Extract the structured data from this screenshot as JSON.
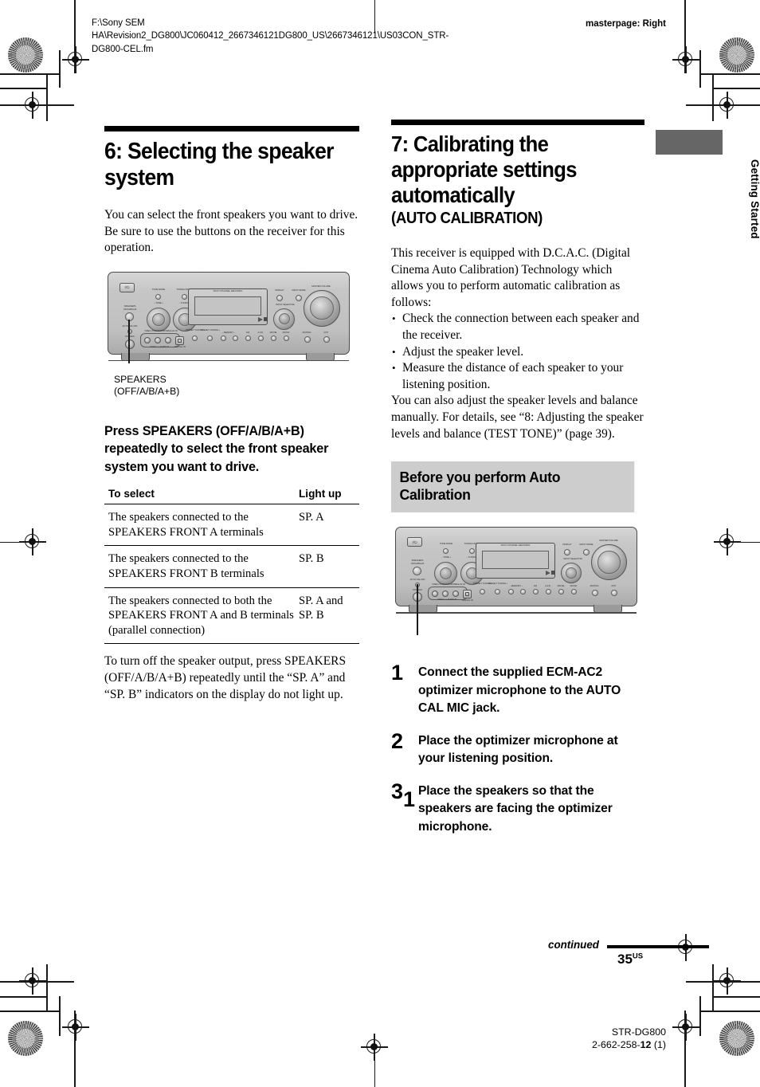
{
  "header": {
    "file_path": "F:\\Sony SEM HA\\Revision2_DG800\\JC060412_2667346121DG800_US\\2667346121\\US03CON_STR-DG800-CEL.fm",
    "masterpage": "masterpage: Right"
  },
  "side_tab": {
    "label": "Getting Started"
  },
  "left_column": {
    "heading": "6: Selecting the speaker system",
    "intro": "You can select the front speakers you want to drive.\nBe sure to use the buttons on the receiver for this operation.",
    "figure_caption": "SPEAKERS\n(OFF/A/B/A+B)",
    "instruction": "Press SPEAKERS (OFF/A/B/A+B) repeatedly to select the front speaker system you want to drive.",
    "table": {
      "headers": [
        "To select",
        "Light up"
      ],
      "rows": [
        [
          "The speakers connected to the SPEAKERS FRONT A terminals",
          "SP. A"
        ],
        [
          "The speakers connected to the SPEAKERS FRONT B terminals",
          "SP. B"
        ],
        [
          "The speakers connected to both the SPEAKERS FRONT A and B terminals (parallel connection)",
          "SP. A and SP. B"
        ]
      ]
    },
    "closing": "To turn off the speaker output, press SPEAKERS (OFF/A/B/A+B) repeatedly until the “SP. A” and “SP. B” indicators on the display do not light up."
  },
  "right_column": {
    "heading": "7: Calibrating the appropriate settings automatically",
    "heading_sub": "(AUTO CALIBRATION)",
    "intro": "This receiver is equipped with D.C.A.C. (Digital Cinema Auto Calibration) Technology which allows you to perform automatic calibration as follows:",
    "bullets": [
      "Check the connection between each speaker and the receiver.",
      "Adjust the speaker level.",
      "Measure the distance of each speaker to your listening position."
    ],
    "after_bullets": "You can also adjust the speaker levels and balance manually. For details, see “8: Adjusting the speaker levels and balance (TEST TONE)” (page 39).",
    "grey_heading": "Before you perform Auto Calibration",
    "figure_callout": "1",
    "steps": [
      {
        "num": "1",
        "text": "Connect the supplied ECM-AC2 optimizer microphone to the AUTO CAL MIC jack."
      },
      {
        "num": "2",
        "text": "Place the optimizer microphone at your listening position."
      },
      {
        "num": "3",
        "text": "Place the speakers so that the speakers are facing the optimizer microphone."
      }
    ]
  },
  "footer": {
    "continued": "continued",
    "page_number": "35",
    "page_number_sup": "US",
    "model": "STR-DG800",
    "part_number_prefix": "2-662-258-",
    "part_number_bold": "12",
    "part_number_suffix": " (1)"
  },
  "receiver_panel": {
    "power_label": "I/⏻",
    "labels": [
      "TONE MODE",
      "TUNING MODE",
      "TONE",
      "TUNING",
      "MULTI CHANNEL DECODING",
      "DISPLAY",
      "INPUT MODE",
      "INPUT SELECTOR",
      "MASTER VOLUME",
      "SPEAKERS (OFF/A/B/A+B)",
      "AUTO CAL MIC",
      "PHONES",
      "VIDEO 3 INPUT/PORTABLE AV IN",
      "VIDEO",
      "L AUDIO R",
      "DIGITAL IN",
      "PRESET TUNING -",
      "PRESET TUNING +",
      "MEMORY",
      "FM",
      "A.F.D.",
      "MOVIE",
      "MUSIC",
      "MUTING",
      "2CH",
      "RESET"
    ]
  },
  "colors": {
    "grey_band": "#cdcdcd",
    "side_tab": "#666666",
    "rule": "#000000",
    "chassis_light": "#d6d6d6",
    "chassis_dark": "#ababab"
  }
}
